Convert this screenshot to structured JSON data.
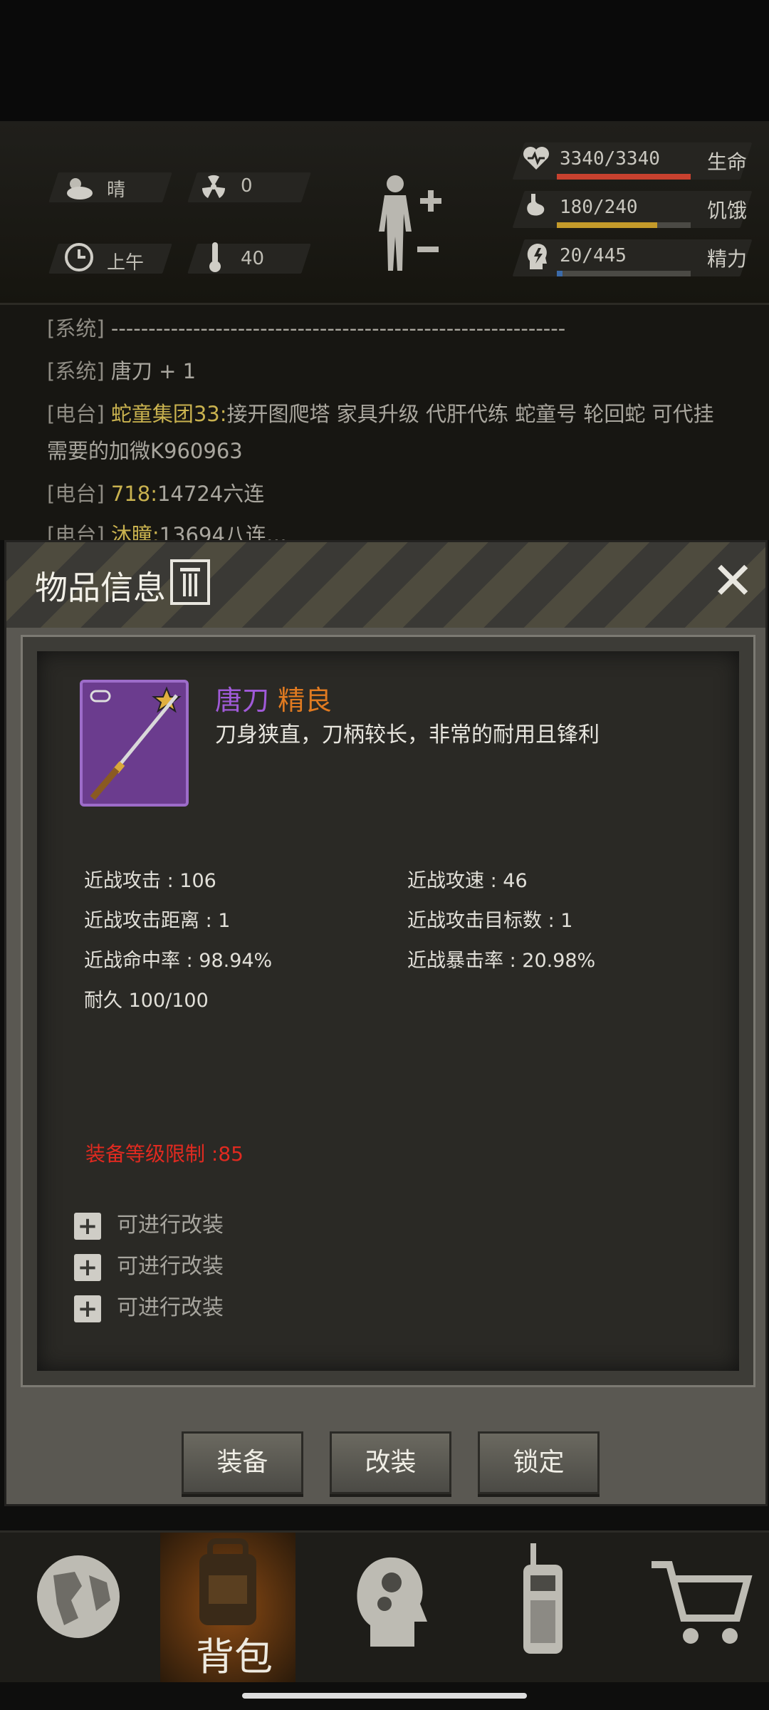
{
  "status": {
    "weather": "晴",
    "radiation": "0",
    "time_of_day": "上午",
    "temperature": "40",
    "health_value": "3340/3340",
    "health_label": "生命",
    "health_color": "#c8412f",
    "health_fraction": 1.0,
    "hunger_value": "180/240",
    "hunger_label": "饥饿",
    "hunger_color": "#c49a2a",
    "hunger_fraction": 0.75,
    "energy_value": "20/445",
    "energy_label": "精力",
    "energy_color": "#3b6aa8",
    "energy_fraction": 0.045
  },
  "chat": {
    "lines": [
      {
        "tag": "[系统]",
        "text": "-------------------------------------------------------------"
      },
      {
        "tag": "[系统]",
        "text": "唐刀 + 1"
      },
      {
        "tag": "[电台]",
        "text": "蛇童集团33:",
        "text2": "接开图爬塔 家具升级 代肝代练 蛇童号 轮回蛇 可代挂"
      },
      {
        "tag": "",
        "text": "需要的加微K960963"
      },
      {
        "tag": "[电台]",
        "text": "718:",
        "text2": "14724六连"
      },
      {
        "tag": "[电台]",
        "text": "沐瞳:",
        "text2": "13694八连…"
      }
    ]
  },
  "modal": {
    "title": "物品信息",
    "item": {
      "name": "唐刀",
      "quality": "精良",
      "name_color": "#a05ad8",
      "quality_color": "#e07a20",
      "description": "刀身狭直，刀柄较长，非常的耐用且锋利"
    },
    "stats_left": [
      "近战攻击 : 106",
      "近战攻击距离 : 1",
      "近战命中率 : 98.94%",
      "耐久 100/100"
    ],
    "stats_right": [
      "近战攻速 : 46",
      "近战攻击目标数 : 1",
      "近战暴击率 : 20.98%"
    ],
    "requirement": "装备等级限制 :85",
    "mods": [
      "可进行改装",
      "可进行改装",
      "可进行改装"
    ],
    "buttons": {
      "equip": "装备",
      "modify": "改装",
      "lock": "锁定"
    }
  },
  "nav": {
    "active_label": "背包",
    "items": [
      "world-map-icon",
      "backpack-icon",
      "skills-head-icon",
      "radio-icon",
      "shop-cart-icon"
    ]
  }
}
